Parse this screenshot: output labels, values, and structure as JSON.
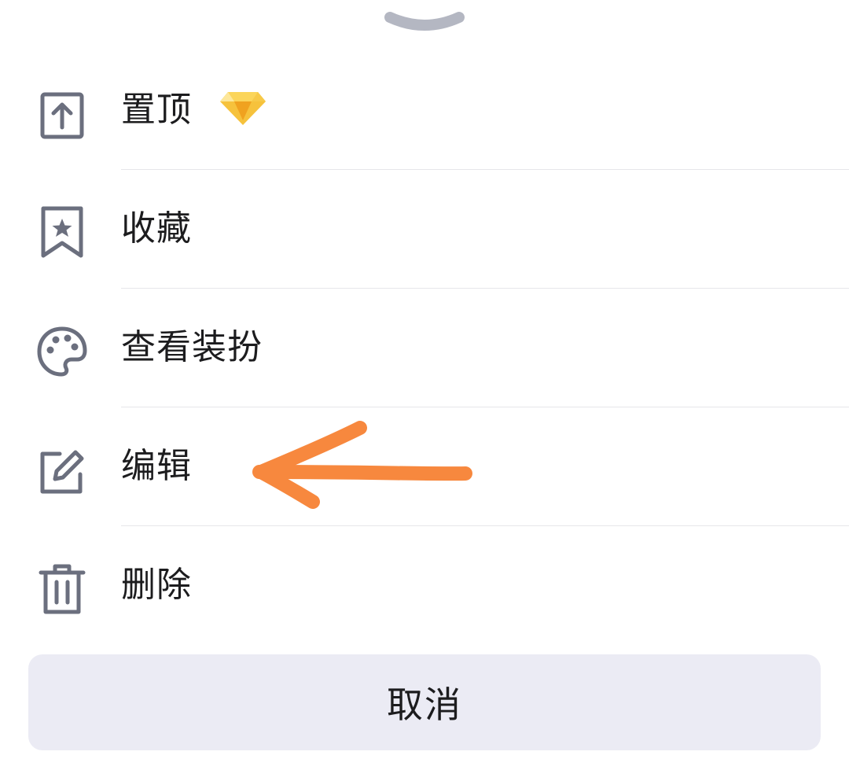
{
  "sheet": {
    "handle_icon": "chevron-down-icon",
    "items": [
      {
        "label": "置顶",
        "icon": "pin-top-icon",
        "badge_icon": "diamond-vip-icon"
      },
      {
        "label": "收藏",
        "icon": "bookmark-star-icon"
      },
      {
        "label": "查看装扮",
        "icon": "palette-icon"
      },
      {
        "label": "编辑",
        "icon": "edit-icon"
      },
      {
        "label": "删除",
        "icon": "trash-icon"
      }
    ],
    "cancel_label": "取消"
  },
  "annotation": {
    "icon": "arrow-left-annotation",
    "color": "#f7883e"
  },
  "colors": {
    "icon": "#6b6f7e",
    "text": "#1c1c1e",
    "divider": "#e6e6ea",
    "cancel_bg": "#ebebf4",
    "badge": "#f5b82e"
  }
}
